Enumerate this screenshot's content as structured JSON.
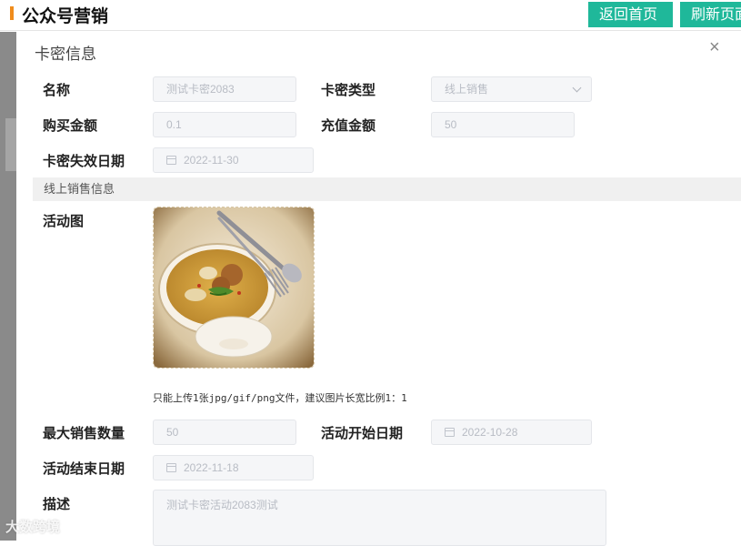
{
  "header": {
    "title": "公众号营销",
    "home_button": "返回首页",
    "refresh_button": "刷新页面",
    "accent_color": "#f08c1c",
    "button_color": "#1fb89a"
  },
  "dialog": {
    "title": "卡密信息",
    "close_icon": "×",
    "fields": {
      "name_label": "名称",
      "name_value": "测试卡密2083",
      "type_label": "卡密类型",
      "type_value": "线上销售",
      "purchase_label": "购买金额",
      "purchase_value": "0.1",
      "recharge_label": "充值金额",
      "recharge_value": "50",
      "expiry_label": "卡密失效日期",
      "expiry_value": "2022-11-30"
    },
    "section_title": "线上销售信息",
    "activity": {
      "image_label": "活动图",
      "upload_hint": "只能上传1张jpg/gif/png文件，建议图片长宽比例1：1",
      "max_sales_label": "最大销售数量",
      "max_sales_value": "50",
      "start_label": "活动开始日期",
      "start_value": "2022-10-28",
      "end_label": "活动结束日期",
      "end_value": "2022-11-18",
      "desc_label": "描述",
      "desc_value": "测试卡密活动2083测试"
    }
  },
  "watermark": "大数跨境"
}
